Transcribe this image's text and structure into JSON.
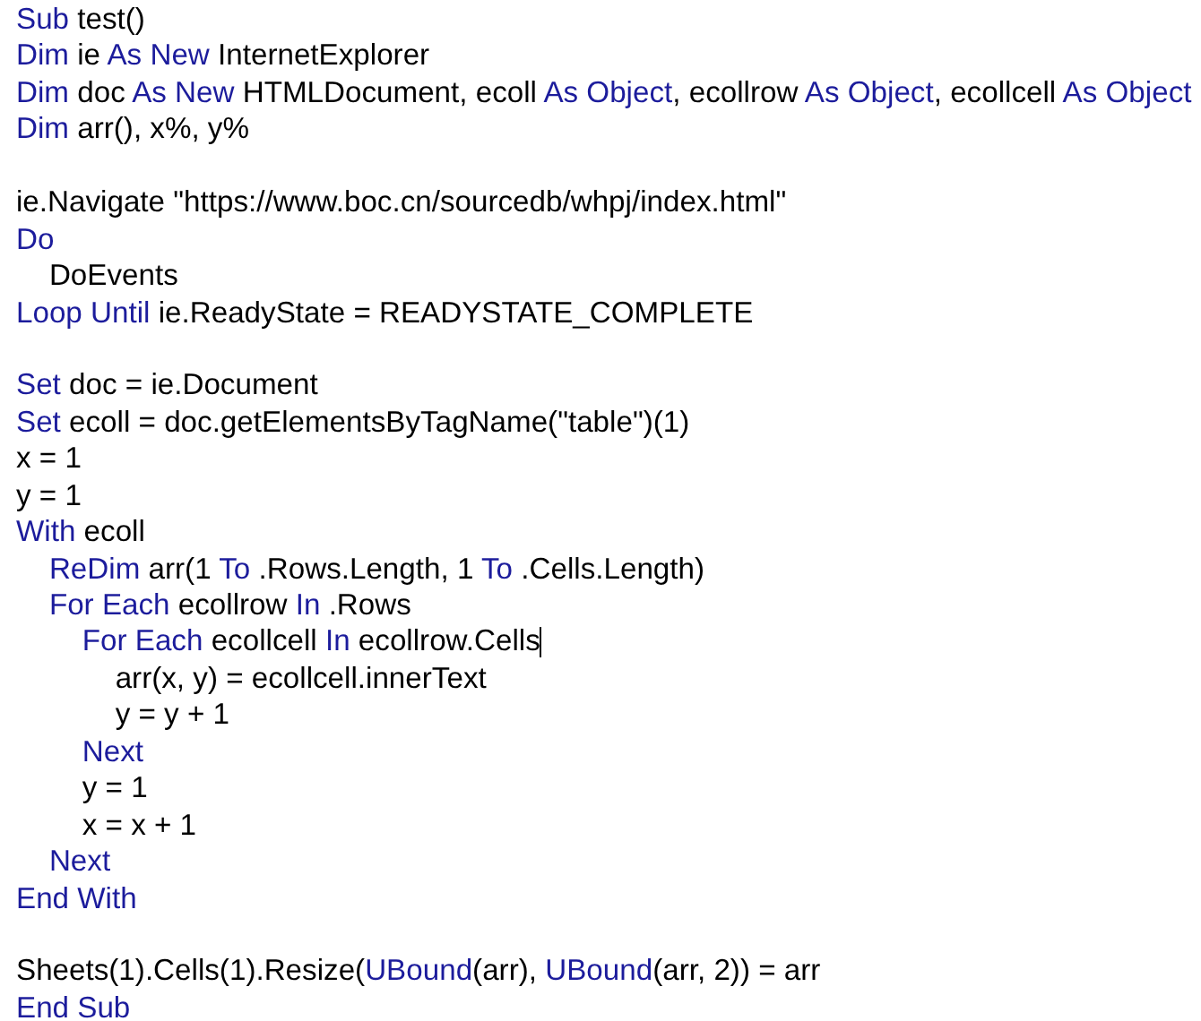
{
  "editor": {
    "lines": [
      {
        "kind": "code",
        "caret": false,
        "tokens": [
          {
            "text": "Sub",
            "kind": "keyword"
          },
          {
            "text": " test()",
            "kind": "plain"
          }
        ]
      },
      {
        "kind": "code",
        "caret": false,
        "tokens": [
          {
            "text": "Dim",
            "kind": "keyword"
          },
          {
            "text": " ie ",
            "kind": "plain"
          },
          {
            "text": "As New",
            "kind": "keyword"
          },
          {
            "text": " InternetExplorer",
            "kind": "plain"
          }
        ]
      },
      {
        "kind": "code",
        "caret": false,
        "tokens": [
          {
            "text": "Dim",
            "kind": "keyword"
          },
          {
            "text": " doc ",
            "kind": "plain"
          },
          {
            "text": "As New",
            "kind": "keyword"
          },
          {
            "text": " HTMLDocument, ecoll ",
            "kind": "plain"
          },
          {
            "text": "As Object",
            "kind": "keyword"
          },
          {
            "text": ", ecollrow ",
            "kind": "plain"
          },
          {
            "text": "As Object",
            "kind": "keyword"
          },
          {
            "text": ", ecollcell ",
            "kind": "plain"
          },
          {
            "text": "As Object",
            "kind": "keyword"
          }
        ]
      },
      {
        "kind": "code",
        "caret": false,
        "tokens": [
          {
            "text": "Dim",
            "kind": "keyword"
          },
          {
            "text": " arr(), x%, y%",
            "kind": "plain"
          }
        ]
      },
      {
        "kind": "blank"
      },
      {
        "kind": "code",
        "caret": false,
        "tokens": [
          {
            "text": "ie.Navigate \"https://www.boc.cn/sourcedb/whpj/index.html\"",
            "kind": "plain"
          }
        ]
      },
      {
        "kind": "code",
        "caret": false,
        "tokens": [
          {
            "text": "Do",
            "kind": "keyword"
          }
        ]
      },
      {
        "kind": "code",
        "caret": false,
        "tokens": [
          {
            "text": "    DoEvents",
            "kind": "plain"
          }
        ]
      },
      {
        "kind": "code",
        "caret": false,
        "tokens": [
          {
            "text": "Loop Until",
            "kind": "keyword"
          },
          {
            "text": " ie.ReadyState = READYSTATE_COMPLETE",
            "kind": "plain"
          }
        ]
      },
      {
        "kind": "blank"
      },
      {
        "kind": "code",
        "caret": false,
        "tokens": [
          {
            "text": "Set",
            "kind": "keyword"
          },
          {
            "text": " doc = ie.Document",
            "kind": "plain"
          }
        ]
      },
      {
        "kind": "code",
        "caret": false,
        "tokens": [
          {
            "text": "Set",
            "kind": "keyword"
          },
          {
            "text": " ecoll = doc.getElementsByTagName(\"table\")(1)",
            "kind": "plain"
          }
        ]
      },
      {
        "kind": "code",
        "caret": false,
        "tokens": [
          {
            "text": "x = 1",
            "kind": "plain"
          }
        ]
      },
      {
        "kind": "code",
        "caret": false,
        "tokens": [
          {
            "text": "y = 1",
            "kind": "plain"
          }
        ]
      },
      {
        "kind": "code",
        "caret": false,
        "tokens": [
          {
            "text": "With",
            "kind": "keyword"
          },
          {
            "text": " ecoll",
            "kind": "plain"
          }
        ]
      },
      {
        "kind": "code",
        "caret": false,
        "tokens": [
          {
            "text": "    ReDim",
            "kind": "keyword"
          },
          {
            "text": " arr(1 ",
            "kind": "plain"
          },
          {
            "text": "To",
            "kind": "keyword"
          },
          {
            "text": " .Rows.Length, 1 ",
            "kind": "plain"
          },
          {
            "text": "To",
            "kind": "keyword"
          },
          {
            "text": " .Cells.Length)",
            "kind": "plain"
          }
        ]
      },
      {
        "kind": "code",
        "caret": false,
        "tokens": [
          {
            "text": "    For Each",
            "kind": "keyword"
          },
          {
            "text": " ecollrow ",
            "kind": "plain"
          },
          {
            "text": "In",
            "kind": "keyword"
          },
          {
            "text": " .Rows",
            "kind": "plain"
          }
        ]
      },
      {
        "kind": "code",
        "caret": true,
        "tokens": [
          {
            "text": "        For Each",
            "kind": "keyword"
          },
          {
            "text": " ecollcell ",
            "kind": "plain"
          },
          {
            "text": "In",
            "kind": "keyword"
          },
          {
            "text": " ecollrow.Cells",
            "kind": "plain"
          }
        ]
      },
      {
        "kind": "code",
        "caret": false,
        "tokens": [
          {
            "text": "            arr(x, y) = ecollcell.innerText",
            "kind": "plain"
          }
        ]
      },
      {
        "kind": "code",
        "caret": false,
        "tokens": [
          {
            "text": "            y = y + 1",
            "kind": "plain"
          }
        ]
      },
      {
        "kind": "code",
        "caret": false,
        "tokens": [
          {
            "text": "        Next",
            "kind": "keyword"
          }
        ]
      },
      {
        "kind": "code",
        "caret": false,
        "tokens": [
          {
            "text": "        y = 1",
            "kind": "plain"
          }
        ]
      },
      {
        "kind": "code",
        "caret": false,
        "tokens": [
          {
            "text": "        x = x + 1",
            "kind": "plain"
          }
        ]
      },
      {
        "kind": "code",
        "caret": false,
        "tokens": [
          {
            "text": "    Next",
            "kind": "keyword"
          }
        ]
      },
      {
        "kind": "code",
        "caret": false,
        "tokens": [
          {
            "text": "End With",
            "kind": "keyword"
          }
        ]
      },
      {
        "kind": "blank"
      },
      {
        "kind": "code",
        "caret": false,
        "tokens": [
          {
            "text": "Sheets(1).Cells(1).Resize(",
            "kind": "plain"
          },
          {
            "text": "UBound",
            "kind": "keyword"
          },
          {
            "text": "(arr), ",
            "kind": "plain"
          },
          {
            "text": "UBound",
            "kind": "keyword"
          },
          {
            "text": "(arr, 2)) = arr",
            "kind": "plain"
          }
        ]
      },
      {
        "kind": "code",
        "caret": false,
        "tokens": [
          {
            "text": "End Sub",
            "kind": "keyword"
          }
        ]
      }
    ]
  }
}
